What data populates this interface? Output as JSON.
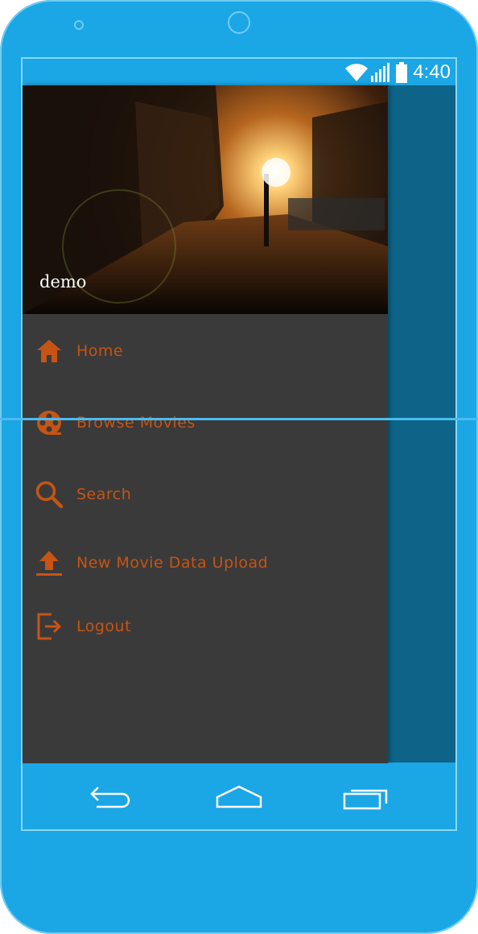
{
  "status_bar": {
    "time": "4:40",
    "icons": [
      "wifi-icon",
      "signal-icon",
      "battery-icon"
    ]
  },
  "drawer": {
    "header": {
      "username": "demo"
    },
    "items": [
      {
        "label": "Home",
        "icon": "home-icon"
      },
      {
        "label": "Browse Movies",
        "icon": "film-reel-icon"
      },
      {
        "label": "Search",
        "icon": "search-icon"
      },
      {
        "label": "New Movie Data Upload",
        "icon": "upload-icon"
      },
      {
        "label": "Logout",
        "icon": "logout-icon"
      }
    ]
  },
  "nav_bar": {
    "buttons": [
      "back-icon",
      "home-icon",
      "recents-icon"
    ]
  },
  "colors": {
    "accent": "#c75414",
    "drawer_bg": "#3a3a3a",
    "device_blue": "#1ba6e6",
    "scrim": "#0d6488"
  }
}
